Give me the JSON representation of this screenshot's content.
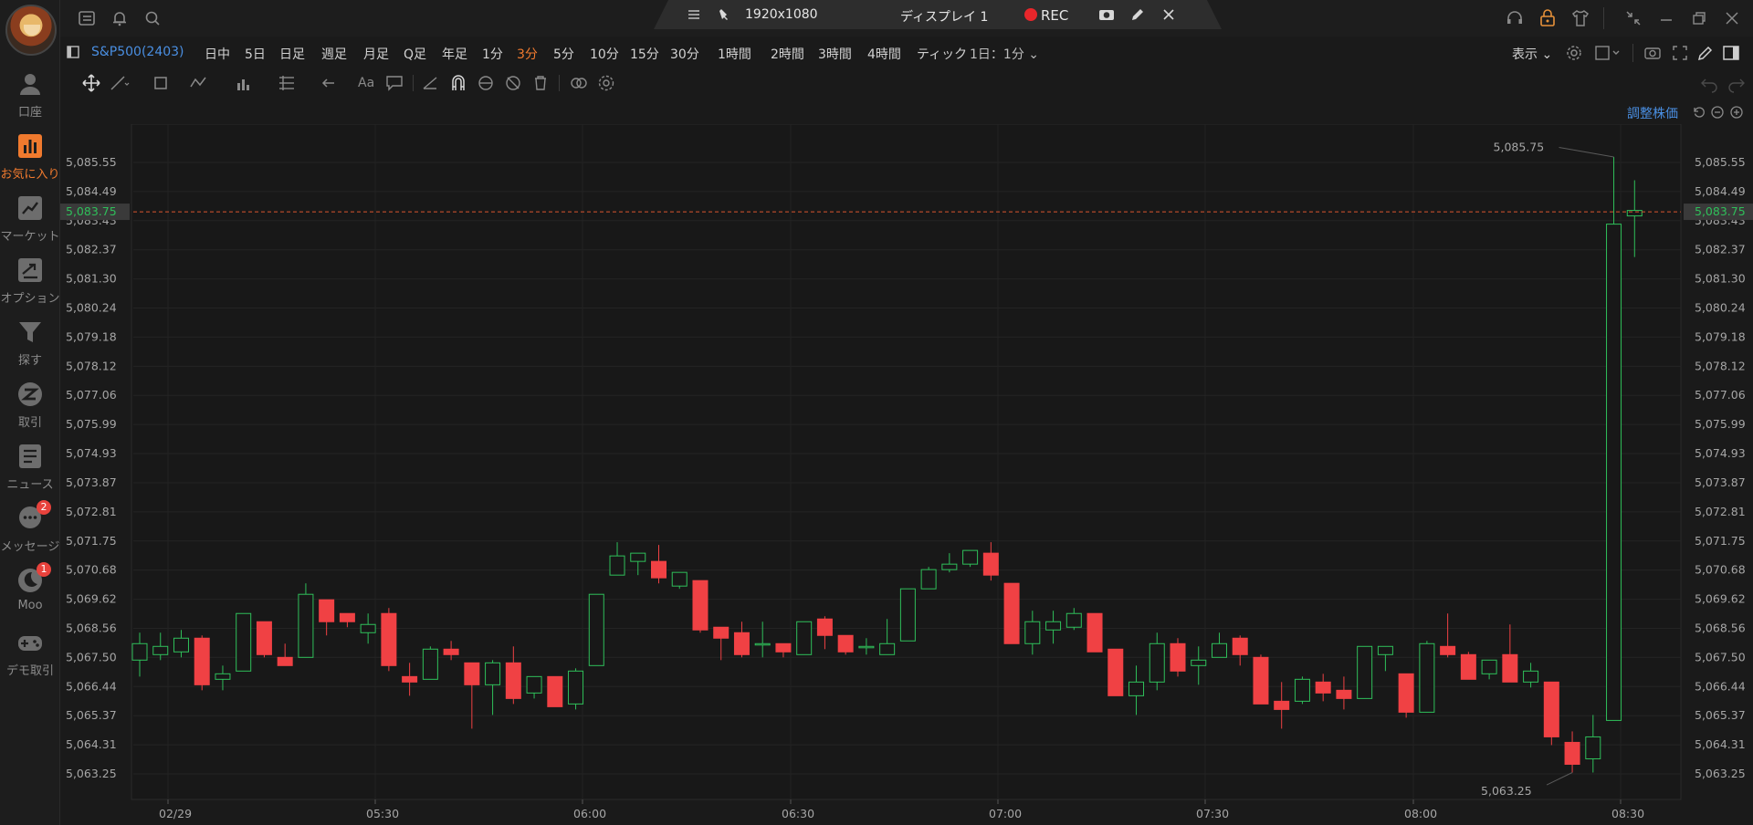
{
  "sidebar": {
    "items": [
      {
        "label": "口座",
        "icon": "user-icon"
      },
      {
        "label": "お気に入り",
        "icon": "bar-chart-icon",
        "active": true
      },
      {
        "label": "マーケット",
        "icon": "trend-icon"
      },
      {
        "label": "オプション",
        "icon": "options-icon"
      },
      {
        "label": "探す",
        "icon": "filter-icon"
      },
      {
        "label": "取引",
        "icon": "trade-icon"
      },
      {
        "label": "ニュース",
        "icon": "news-icon"
      },
      {
        "label": "メッセージ",
        "icon": "message-icon",
        "badge": "2"
      },
      {
        "label": "Moo",
        "icon": "moo-icon",
        "badge": "1"
      },
      {
        "label": "デモ取引",
        "icon": "gamepad-icon"
      }
    ]
  },
  "topbar": {
    "resolution": "1920x1080",
    "display": "ディスプレイ 1",
    "rec": "REC"
  },
  "timeframes": {
    "symbol": "S&P500(2403)",
    "items": [
      "日中",
      "5日",
      "日足",
      "週足",
      "月足",
      "Q足",
      "年足",
      "1分",
      "3分",
      "5分",
      "10分",
      "15分",
      "30分",
      "1時間",
      "2時間",
      "3時間",
      "4時間",
      "ティック"
    ],
    "active": "3分",
    "range": "1日：1分",
    "view": "表示"
  },
  "chart": {
    "adjust_label": "調整株価",
    "current_price": "5,083.75",
    "high_label": "5,085.75",
    "low_label": "5,063.25",
    "colors": {
      "up": "#2fbf5a",
      "down": "#f04144",
      "price_line": "#d9542f"
    }
  },
  "chart_data": {
    "type": "candlestick",
    "y_ticks": [
      "5,085.55",
      "5,084.49",
      "5,083.43",
      "5,082.37",
      "5,081.30",
      "5,080.24",
      "5,079.18",
      "5,078.12",
      "5,077.06",
      "5,075.99",
      "5,074.93",
      "5,073.87",
      "5,072.81",
      "5,071.75",
      "5,070.68",
      "5,069.62",
      "5,068.56",
      "5,067.50",
      "5,066.44",
      "5,065.37",
      "5,064.31",
      "5,063.25"
    ],
    "x_ticks": [
      "02/29",
      "05:30",
      "06:00",
      "06:30",
      "07:00",
      "07:30",
      "08:00",
      "08:30"
    ],
    "ylim": [
      5062.6,
      5087.4
    ],
    "candles": [
      {
        "o": 5067.4,
        "h": 5068.4,
        "l": 5066.8,
        "c": 5068.0
      },
      {
        "o": 5067.6,
        "h": 5068.4,
        "l": 5067.4,
        "c": 5067.9
      },
      {
        "o": 5067.7,
        "h": 5068.5,
        "l": 5067.5,
        "c": 5068.2
      },
      {
        "o": 5068.2,
        "h": 5068.3,
        "l": 5066.3,
        "c": 5066.5
      },
      {
        "o": 5066.7,
        "h": 5067.2,
        "l": 5066.3,
        "c": 5066.9
      },
      {
        "o": 5067.0,
        "h": 5069.1,
        "l": 5067.0,
        "c": 5069.1
      },
      {
        "o": 5068.8,
        "h": 5068.8,
        "l": 5067.5,
        "c": 5067.6
      },
      {
        "o": 5067.5,
        "h": 5068.0,
        "l": 5067.2,
        "c": 5067.2
      },
      {
        "o": 5067.5,
        "h": 5070.2,
        "l": 5067.5,
        "c": 5069.8
      },
      {
        "o": 5069.6,
        "h": 5069.6,
        "l": 5068.3,
        "c": 5068.8
      },
      {
        "o": 5069.1,
        "h": 5069.1,
        "l": 5068.6,
        "c": 5068.8
      },
      {
        "o": 5068.4,
        "h": 5069.1,
        "l": 5068.0,
        "c": 5068.7
      },
      {
        "o": 5069.1,
        "h": 5069.3,
        "l": 5067.0,
        "c": 5067.2
      },
      {
        "o": 5066.8,
        "h": 5067.3,
        "l": 5066.1,
        "c": 5066.6
      },
      {
        "o": 5066.7,
        "h": 5067.9,
        "l": 5066.7,
        "c": 5067.8
      },
      {
        "o": 5067.8,
        "h": 5068.1,
        "l": 5067.4,
        "c": 5067.6
      },
      {
        "o": 5067.3,
        "h": 5067.3,
        "l": 5064.9,
        "c": 5066.5
      },
      {
        "o": 5066.5,
        "h": 5067.4,
        "l": 5065.4,
        "c": 5067.3
      },
      {
        "o": 5067.3,
        "h": 5067.9,
        "l": 5065.8,
        "c": 5066.0
      },
      {
        "o": 5066.2,
        "h": 5066.8,
        "l": 5066.0,
        "c": 5066.8
      },
      {
        "o": 5066.8,
        "h": 5066.8,
        "l": 5065.7,
        "c": 5065.7
      },
      {
        "o": 5065.8,
        "h": 5067.1,
        "l": 5065.6,
        "c": 5067.0
      },
      {
        "o": 5067.2,
        "h": 5069.8,
        "l": 5067.2,
        "c": 5069.8
      },
      {
        "o": 5070.5,
        "h": 5071.7,
        "l": 5070.5,
        "c": 5071.2
      },
      {
        "o": 5071.0,
        "h": 5071.3,
        "l": 5070.5,
        "c": 5071.3
      },
      {
        "o": 5071.0,
        "h": 5071.6,
        "l": 5070.2,
        "c": 5070.4
      },
      {
        "o": 5070.1,
        "h": 5070.6,
        "l": 5070.0,
        "c": 5070.6
      },
      {
        "o": 5070.3,
        "h": 5070.3,
        "l": 5068.4,
        "c": 5068.5
      },
      {
        "o": 5068.6,
        "h": 5068.6,
        "l": 5067.4,
        "c": 5068.2
      },
      {
        "o": 5068.4,
        "h": 5068.8,
        "l": 5067.5,
        "c": 5067.6
      },
      {
        "o": 5068.0,
        "h": 5068.8,
        "l": 5067.5,
        "c": 5068.0
      },
      {
        "o": 5068.0,
        "h": 5068.0,
        "l": 5067.5,
        "c": 5067.7
      },
      {
        "o": 5067.6,
        "h": 5068.8,
        "l": 5067.6,
        "c": 5068.8
      },
      {
        "o": 5068.9,
        "h": 5069.0,
        "l": 5067.8,
        "c": 5068.3
      },
      {
        "o": 5068.3,
        "h": 5068.3,
        "l": 5067.6,
        "c": 5067.7
      },
      {
        "o": 5067.9,
        "h": 5068.2,
        "l": 5067.6,
        "c": 5067.9
      },
      {
        "o": 5067.6,
        "h": 5068.9,
        "l": 5067.6,
        "c": 5068.0
      },
      {
        "o": 5068.1,
        "h": 5070.0,
        "l": 5068.1,
        "c": 5070.0
      },
      {
        "o": 5070.0,
        "h": 5070.8,
        "l": 5070.0,
        "c": 5070.7
      },
      {
        "o": 5070.7,
        "h": 5071.3,
        "l": 5070.6,
        "c": 5070.9
      },
      {
        "o": 5070.9,
        "h": 5071.4,
        "l": 5070.8,
        "c": 5071.4
      },
      {
        "o": 5071.3,
        "h": 5071.7,
        "l": 5070.3,
        "c": 5070.5
      },
      {
        "o": 5070.2,
        "h": 5070.2,
        "l": 5068.0,
        "c": 5068.0
      },
      {
        "o": 5068.0,
        "h": 5069.2,
        "l": 5067.6,
        "c": 5068.8
      },
      {
        "o": 5068.5,
        "h": 5069.2,
        "l": 5068.0,
        "c": 5068.8
      },
      {
        "o": 5068.6,
        "h": 5069.3,
        "l": 5068.5,
        "c": 5069.1
      },
      {
        "o": 5069.1,
        "h": 5069.1,
        "l": 5067.7,
        "c": 5067.7
      },
      {
        "o": 5067.8,
        "h": 5067.8,
        "l": 5066.1,
        "c": 5066.1
      },
      {
        "o": 5066.1,
        "h": 5067.2,
        "l": 5065.4,
        "c": 5066.6
      },
      {
        "o": 5066.6,
        "h": 5068.4,
        "l": 5066.3,
        "c": 5068.0
      },
      {
        "o": 5068.0,
        "h": 5068.2,
        "l": 5066.8,
        "c": 5067.0
      },
      {
        "o": 5067.2,
        "h": 5067.9,
        "l": 5066.5,
        "c": 5067.4
      },
      {
        "o": 5067.5,
        "h": 5068.4,
        "l": 5067.5,
        "c": 5068.0
      },
      {
        "o": 5068.2,
        "h": 5068.3,
        "l": 5067.2,
        "c": 5067.6
      },
      {
        "o": 5067.5,
        "h": 5067.6,
        "l": 5065.8,
        "c": 5065.8
      },
      {
        "o": 5065.9,
        "h": 5066.6,
        "l": 5064.9,
        "c": 5065.6
      },
      {
        "o": 5065.9,
        "h": 5066.8,
        "l": 5065.8,
        "c": 5066.7
      },
      {
        "o": 5066.6,
        "h": 5066.9,
        "l": 5065.9,
        "c": 5066.2
      },
      {
        "o": 5066.3,
        "h": 5066.8,
        "l": 5065.6,
        "c": 5066.0
      },
      {
        "o": 5066.0,
        "h": 5067.9,
        "l": 5066.0,
        "c": 5067.9
      },
      {
        "o": 5067.6,
        "h": 5067.9,
        "l": 5067.0,
        "c": 5067.9
      },
      {
        "o": 5066.9,
        "h": 5066.9,
        "l": 5065.3,
        "c": 5065.5
      },
      {
        "o": 5065.5,
        "h": 5068.1,
        "l": 5065.5,
        "c": 5068.0
      },
      {
        "o": 5067.9,
        "h": 5069.1,
        "l": 5067.5,
        "c": 5067.6
      },
      {
        "o": 5067.6,
        "h": 5067.7,
        "l": 5066.7,
        "c": 5066.7
      },
      {
        "o": 5066.9,
        "h": 5067.4,
        "l": 5066.7,
        "c": 5067.4
      },
      {
        "o": 5067.6,
        "h": 5068.7,
        "l": 5066.6,
        "c": 5066.6
      },
      {
        "o": 5066.6,
        "h": 5067.3,
        "l": 5066.4,
        "c": 5067.0
      },
      {
        "o": 5066.6,
        "h": 5066.6,
        "l": 5064.3,
        "c": 5064.6
      },
      {
        "o": 5064.4,
        "h": 5064.8,
        "l": 5063.3,
        "c": 5063.6
      },
      {
        "o": 5063.8,
        "h": 5065.4,
        "l": 5063.3,
        "c": 5064.6
      },
      {
        "o": 5065.2,
        "h": 5085.75,
        "l": 5065.2,
        "c": 5083.3
      },
      {
        "o": 5083.6,
        "h": 5084.9,
        "l": 5082.1,
        "c": 5083.8
      }
    ]
  }
}
